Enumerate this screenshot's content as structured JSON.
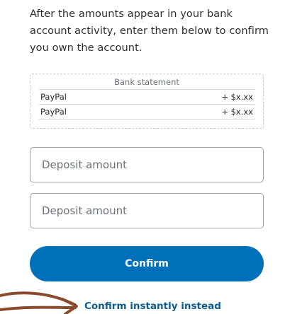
{
  "instructions": "After the amounts appear in your bank account activity, enter them below to confirm you own the account.",
  "statement": {
    "title": "Bank statement",
    "rows": [
      {
        "name": "PayPal",
        "amount": "+ $x.xx"
      },
      {
        "name": "PayPal",
        "amount": "+ $x.xx"
      }
    ]
  },
  "fields": {
    "deposit_1_placeholder": "Deposit amount",
    "deposit_2_placeholder": "Deposit amount"
  },
  "confirm_label": "Confirm",
  "instant_link_label": "Confirm instantly instead",
  "colors": {
    "primary_button": "#0070ba",
    "link": "#0d5c8f",
    "annotation_arrow": "#8b4a2b"
  },
  "annotation": {
    "icon": "hand-drawn-arrow-icon"
  }
}
